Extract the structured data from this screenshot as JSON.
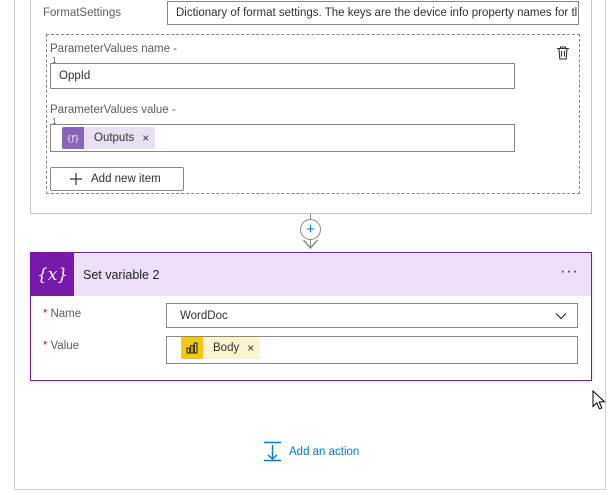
{
  "format_settings": {
    "label": "FormatSettings",
    "value": "Dictionary of format settings. The keys are the device info property names for tl"
  },
  "parameter_values": {
    "name_label": "ParameterValues name -",
    "name_index": "1",
    "name_value": "OppId",
    "value_label": "ParameterValues value -",
    "value_index": "1",
    "value_token": "Outputs",
    "add_item_label": "Add new item"
  },
  "connector": {
    "plus": "+"
  },
  "set_variable": {
    "icon_text": "{x}",
    "title": "Set variable 2",
    "menu": "···",
    "name_label": "Name",
    "name_value": "WordDoc",
    "value_label": "Value",
    "value_token": "Body",
    "required_marker": "*",
    "token_remove": "×"
  },
  "add_action": {
    "label": "Add an action"
  },
  "colors": {
    "accent": "#0078d4",
    "variable_purple": "#7719aa",
    "variable_header": "#ecdff7",
    "expression_token": "#8764b8",
    "powerbi_yellow": "#f2c811"
  }
}
